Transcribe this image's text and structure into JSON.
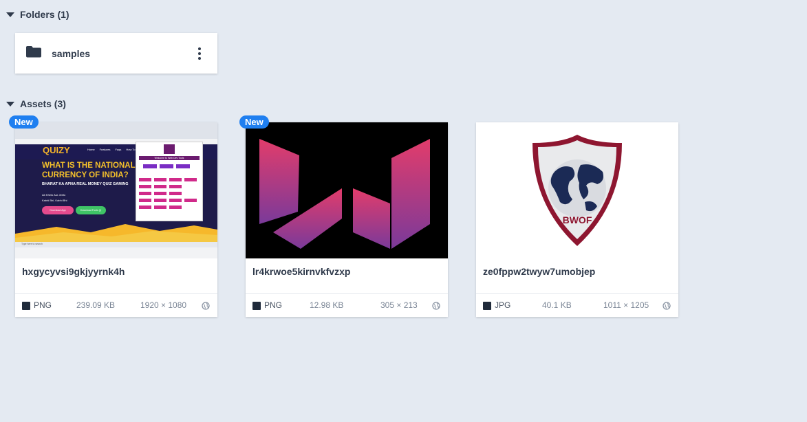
{
  "folders_section": {
    "label": "Folders (1)"
  },
  "folder": {
    "name": "samples",
    "icon": "folder-icon"
  },
  "assets_section": {
    "label": "Assets (3)"
  },
  "new_badge": "New",
  "quizy_thumb": {
    "brand": "QUIZY",
    "nav": [
      "Home",
      "Features",
      "Faqs",
      "How To Install"
    ],
    "headline_1": "WHAT IS THE NATIONAL",
    "headline_2": "CURRENCY OF INDIA?",
    "subline": "BHARAT KA APNA REAL MONEY QUIZ GAMING",
    "tag_1": "Ab Khelo Aur Jeeto",
    "tag_2": "Kabhi Bhi, Kabhi Bhi",
    "btn_1": "Download App",
    "btn_2": "Download Fonts (i)",
    "popup_title": "Welcome to Web Dev Tools",
    "search_placeholder": "Type here to search"
  },
  "bwof_thumb": {
    "text": "BWOF"
  },
  "assets": [
    {
      "name": "hxgycyvsi9gkjyyrnk4h",
      "type": "PNG",
      "size": "239.09 KB",
      "dimensions": "1920 × 1080"
    },
    {
      "name": "lr4krwoe5kirnvkfvzxp",
      "type": "PNG",
      "size": "12.98 KB",
      "dimensions": "305 × 213"
    },
    {
      "name": "ze0fppw2twyw7umobjep",
      "type": "JPG",
      "size": "40.1 KB",
      "dimensions": "1011 × 1205"
    }
  ],
  "colors": {
    "background": "#e4eaf2",
    "badge": "#1f7ff0",
    "text": "#2f3a4b",
    "muted": "#7a8595"
  }
}
